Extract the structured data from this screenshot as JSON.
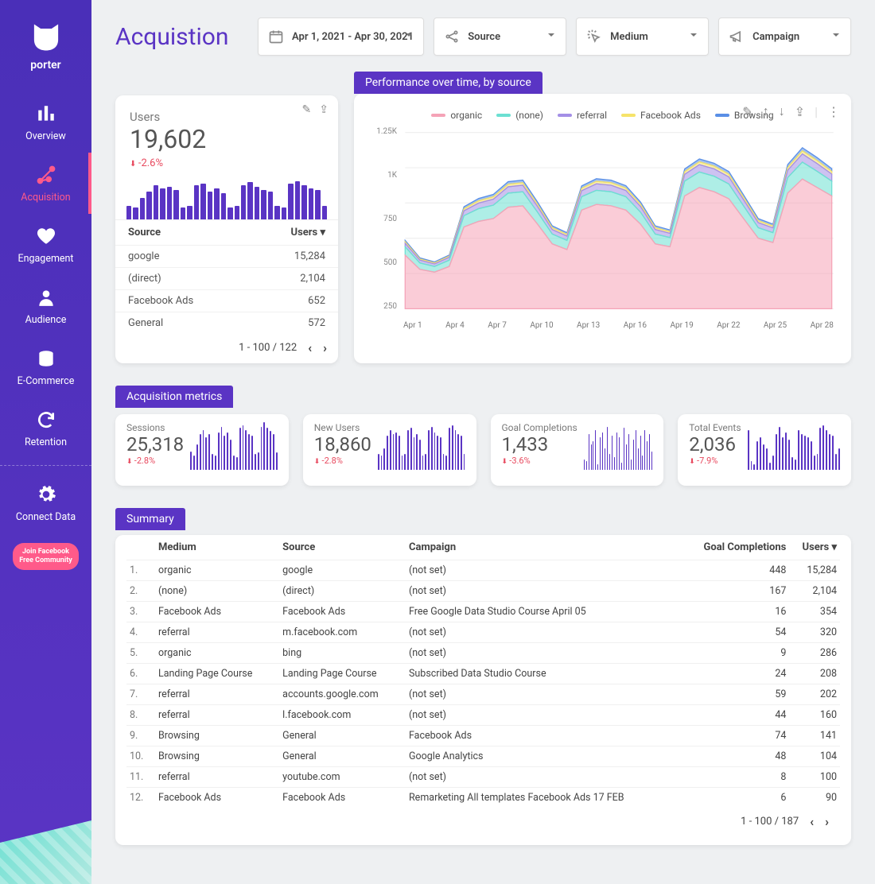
{
  "brand": "porter",
  "page_title": "Acquistion",
  "filters": {
    "date_range": "Apr 1, 2021 - Apr 30, 2021",
    "source_label": "Source",
    "medium_label": "Medium",
    "campaign_label": "Campaign"
  },
  "sidebar": {
    "items": [
      {
        "label": "Overview"
      },
      {
        "label": "Acquisition"
      },
      {
        "label": "Engagement"
      },
      {
        "label": "Audience"
      },
      {
        "label": "E-Commerce"
      },
      {
        "label": "Retention"
      }
    ],
    "connect": "Connect Data",
    "join_btn_l1": "Join Facebook",
    "join_btn_l2": "Free Community"
  },
  "users_card": {
    "label": "Users",
    "value": "19,602",
    "delta": "-2.6%",
    "source_col": "Source",
    "users_col": "Users ▾",
    "rows": [
      {
        "source": "google",
        "users": "15,284"
      },
      {
        "source": "(direct)",
        "users": "2,104"
      },
      {
        "source": "Facebook Ads",
        "users": "652"
      },
      {
        "source": "General",
        "users": "572"
      }
    ],
    "pager": "1 - 100 / 122",
    "spark_bars": [
      22,
      20,
      35,
      45,
      55,
      50,
      52,
      48,
      20,
      22,
      55,
      58,
      45,
      50,
      42,
      20,
      22,
      55,
      60,
      52,
      48,
      45,
      22,
      20,
      58,
      62,
      55,
      50,
      48,
      22
    ]
  },
  "performance": {
    "title": "Performance over time, by source",
    "legend": [
      {
        "name": "organic",
        "color": "#f5a3b7"
      },
      {
        "name": "(none)",
        "color": "#6ce0d2"
      },
      {
        "name": "referral",
        "color": "#a48fe6"
      },
      {
        "name": "Facebook Ads",
        "color": "#f6e36a"
      },
      {
        "name": "Browsing",
        "color": "#5a8fe6"
      }
    ],
    "y_ticks": [
      "1.25K",
      "1K",
      "750",
      "500",
      "250"
    ],
    "x_ticks": [
      "Apr 1",
      "Apr 4",
      "Apr 7",
      "Apr 10",
      "Apr 13",
      "Apr 16",
      "Apr 19",
      "Apr 22",
      "Apr 25",
      "Apr 28"
    ]
  },
  "chart_data": {
    "type": "area",
    "title": "Performance over time, by source",
    "xlabel": "",
    "ylabel": "",
    "ylim": [
      0,
      1250
    ],
    "x": [
      "Apr 1",
      "Apr 2",
      "Apr 3",
      "Apr 4",
      "Apr 5",
      "Apr 6",
      "Apr 7",
      "Apr 8",
      "Apr 9",
      "Apr 10",
      "Apr 11",
      "Apr 12",
      "Apr 13",
      "Apr 14",
      "Apr 15",
      "Apr 16",
      "Apr 17",
      "Apr 18",
      "Apr 19",
      "Apr 20",
      "Apr 21",
      "Apr 22",
      "Apr 23",
      "Apr 24",
      "Apr 25",
      "Apr 26",
      "Apr 27",
      "Apr 28",
      "Apr 29",
      "Apr 30"
    ],
    "series": [
      {
        "name": "organic",
        "color": "#f5a3b7",
        "values": [
          380,
          280,
          260,
          300,
          580,
          620,
          640,
          720,
          730,
          600,
          460,
          420,
          700,
          740,
          730,
          700,
          600,
          460,
          440,
          800,
          860,
          830,
          780,
          640,
          500,
          470,
          820,
          920,
          860,
          800
        ]
      },
      {
        "name": "(none)",
        "color": "#6ce0d2",
        "values": [
          60,
          45,
          40,
          45,
          80,
          90,
          95,
          100,
          100,
          85,
          70,
          65,
          95,
          100,
          100,
          95,
          85,
          70,
          65,
          105,
          110,
          110,
          105,
          90,
          75,
          70,
          110,
          120,
          115,
          105
        ]
      },
      {
        "name": "referral",
        "color": "#a48fe6",
        "values": [
          25,
          20,
          18,
          20,
          35,
          40,
          42,
          45,
          46,
          40,
          32,
          30,
          42,
          46,
          46,
          44,
          40,
          32,
          30,
          48,
          52,
          52,
          50,
          44,
          36,
          34,
          52,
          58,
          55,
          50
        ]
      },
      {
        "name": "Facebook Ads",
        "color": "#f6e36a",
        "values": [
          10,
          8,
          7,
          8,
          14,
          16,
          17,
          18,
          18,
          16,
          13,
          12,
          17,
          18,
          18,
          17,
          16,
          13,
          12,
          19,
          20,
          20,
          19,
          17,
          14,
          13,
          20,
          22,
          21,
          19
        ]
      },
      {
        "name": "Browsing",
        "color": "#5a8fe6",
        "values": [
          10,
          8,
          7,
          8,
          14,
          16,
          17,
          18,
          18,
          16,
          13,
          12,
          17,
          18,
          18,
          17,
          16,
          13,
          12,
          19,
          20,
          20,
          19,
          17,
          14,
          13,
          20,
          22,
          21,
          19
        ]
      }
    ]
  },
  "metrics_section_title": "Acquisition metrics",
  "metrics": [
    {
      "label": "Sessions",
      "value": "25,318",
      "delta": "-2.8%",
      "bars": [
        25,
        20,
        35,
        50,
        55,
        45,
        50,
        22,
        20,
        52,
        60,
        48,
        52,
        42,
        20,
        18,
        58,
        62,
        55,
        50,
        48,
        22,
        24,
        60,
        66,
        58,
        54,
        50,
        24
      ]
    },
    {
      "label": "New Users",
      "value": "18,860",
      "delta": "-2.8%",
      "bars": [
        22,
        20,
        30,
        48,
        55,
        50,
        52,
        48,
        20,
        22,
        55,
        58,
        45,
        50,
        42,
        20,
        22,
        55,
        60,
        52,
        48,
        45,
        22,
        20,
        58,
        62,
        55,
        50,
        48,
        22
      ]
    },
    {
      "label": "Goal Completions",
      "value": "1,433",
      "delta": "-3.6%",
      "bars": [
        15,
        12,
        50,
        35,
        40,
        55,
        8,
        45,
        52,
        30,
        60,
        22,
        48,
        18,
        52,
        45,
        10,
        58,
        35,
        50,
        15,
        42,
        55,
        30,
        48,
        20,
        55,
        40,
        50,
        25
      ]
    },
    {
      "label": "Total Events",
      "value": "2,036",
      "delta": "-7.9%",
      "bars": [
        55,
        12,
        8,
        40,
        45,
        35,
        30,
        10,
        20,
        50,
        60,
        45,
        52,
        42,
        18,
        15,
        55,
        50,
        48,
        45,
        40,
        20,
        22,
        58,
        62,
        55,
        50,
        48,
        22,
        30
      ]
    }
  ],
  "summary": {
    "title": "Summary",
    "columns": [
      "Medium",
      "Source",
      "Campaign",
      "Goal Completions",
      "Users ▾"
    ],
    "rows": [
      {
        "i": "1.",
        "medium": "organic",
        "source": "google",
        "campaign": "(not set)",
        "gc": "448",
        "users": "15,284"
      },
      {
        "i": "2.",
        "medium": "(none)",
        "source": "(direct)",
        "campaign": "(not set)",
        "gc": "167",
        "users": "2,104"
      },
      {
        "i": "3.",
        "medium": "Facebook Ads",
        "source": "Facebook Ads",
        "campaign": "Free Google Data Studio Course April 05",
        "gc": "16",
        "users": "354"
      },
      {
        "i": "4.",
        "medium": "referral",
        "source": "m.facebook.com",
        "campaign": "(not set)",
        "gc": "54",
        "users": "320"
      },
      {
        "i": "5.",
        "medium": "organic",
        "source": "bing",
        "campaign": "(not set)",
        "gc": "9",
        "users": "286"
      },
      {
        "i": "6.",
        "medium": "Landing Page Course",
        "source": "Landing Page Course",
        "campaign": "Subscribed Data Studio Course",
        "gc": "24",
        "users": "208"
      },
      {
        "i": "7.",
        "medium": "referral",
        "source": "accounts.google.com",
        "campaign": "(not set)",
        "gc": "59",
        "users": "202"
      },
      {
        "i": "8.",
        "medium": "referral",
        "source": "l.facebook.com",
        "campaign": "(not set)",
        "gc": "44",
        "users": "160"
      },
      {
        "i": "9.",
        "medium": "Browsing",
        "source": "General",
        "campaign": "Facebook Ads",
        "gc": "74",
        "users": "141"
      },
      {
        "i": "10.",
        "medium": "Browsing",
        "source": "General",
        "campaign": "Google Analytics",
        "gc": "48",
        "users": "104"
      },
      {
        "i": "11.",
        "medium": "referral",
        "source": "youtube.com",
        "campaign": "(not set)",
        "gc": "8",
        "users": "100"
      },
      {
        "i": "12.",
        "medium": "Facebook Ads",
        "source": "Facebook Ads",
        "campaign": "Remarketing All templates Facebook Ads 17 FEB",
        "gc": "6",
        "users": "90"
      }
    ],
    "pager": "1 - 100 / 187"
  }
}
